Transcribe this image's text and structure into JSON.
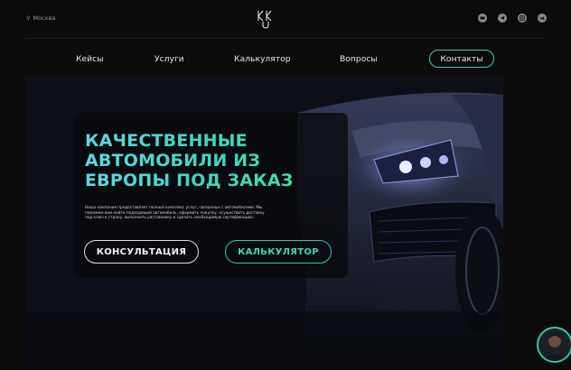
{
  "header": {
    "city": "Москва",
    "logo_text": "KK"
  },
  "socials": [
    {
      "name": "youtube-icon"
    },
    {
      "name": "telegram-icon"
    },
    {
      "name": "instagram-icon"
    },
    {
      "name": "vk-icon"
    }
  ],
  "nav": {
    "cases": "Кейсы",
    "services": "Услуги",
    "calculator": "Калькулятор",
    "questions": "Вопросы",
    "contacts": "Контакты"
  },
  "hero": {
    "title": "КАЧЕСТВЕННЫЕ АВТОМОБИЛИ ИЗ ЕВРОПЫ ПОД ЗАКАЗ",
    "description": "Наша компания предоставляет полный комплекс услуг, связанных с автомобилями. Мы поможем вам найти подходящий автомобиль, оформить покупку, осуществить доставку под ключ в страну, выполнить растаможку и сделать необходимую сертификацию.",
    "consult_label": "КОНСУЛЬТАЦИЯ",
    "calc_label": "КАЛЬКУЛЯТОР"
  },
  "colors": {
    "accent": "#36d1ad",
    "background": "#0b0b0c"
  }
}
